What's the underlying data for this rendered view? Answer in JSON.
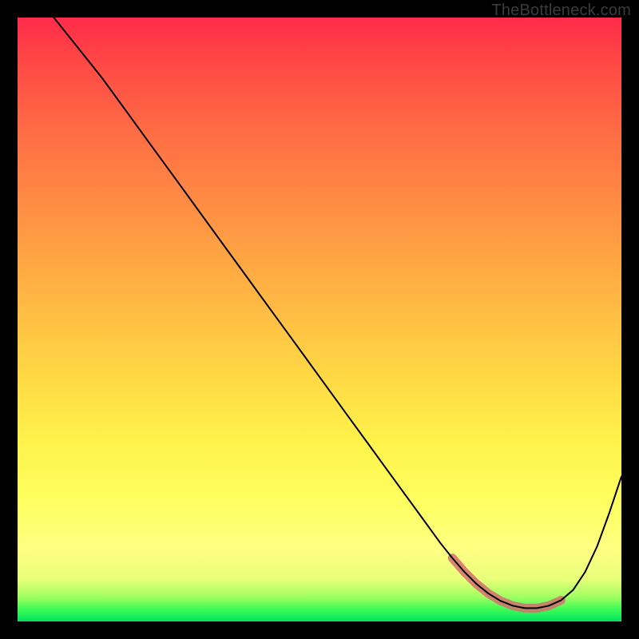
{
  "watermark": "TheBottleneck.com",
  "chart_data": {
    "type": "line",
    "title": "",
    "xlabel": "",
    "ylabel": "",
    "xlim": [
      0,
      100
    ],
    "ylim": [
      0,
      100
    ],
    "series": [
      {
        "name": "curve",
        "x": [
          6,
          10,
          14,
          18,
          22,
          26,
          30,
          34,
          38,
          42,
          46,
          50,
          54,
          58,
          62,
          66,
          70,
          72,
          74,
          76,
          78,
          80,
          82,
          84,
          86,
          88,
          90,
          92,
          94,
          96,
          98,
          100
        ],
        "y": [
          100,
          95,
          90,
          84.5,
          79,
          73.5,
          68,
          62.5,
          57,
          51.5,
          46,
          40.5,
          35,
          29.5,
          24,
          18.5,
          13,
          10.5,
          8.2,
          6.2,
          4.6,
          3.4,
          2.6,
          2.2,
          2.2,
          2.6,
          3.5,
          5.2,
          8.2,
          12.5,
          18,
          24
        ]
      }
    ],
    "highlight": {
      "name": "bottleneck-zone",
      "x": [
        72,
        74,
        76,
        78,
        80,
        82,
        84,
        86,
        88,
        90
      ],
      "y": [
        10.5,
        8.2,
        6.2,
        4.6,
        3.4,
        2.6,
        2.2,
        2.2,
        2.6,
        3.5
      ]
    },
    "colors": {
      "curve": "#000000",
      "highlight": "#d66f6f",
      "gradient_top": "#ff2b4a",
      "gradient_bottom": "#00e35e"
    }
  }
}
